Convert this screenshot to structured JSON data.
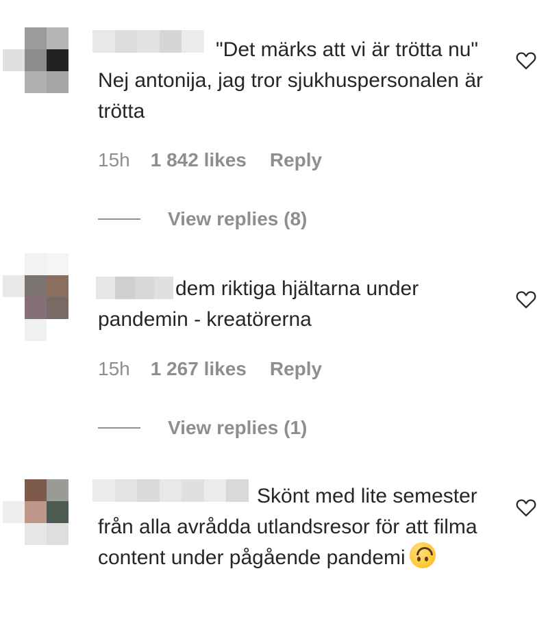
{
  "comments": [
    {
      "text": "\"Det märks att vi är trötta nu\" Nej antonija, jag tror sjukhuspersonalen är trötta",
      "time": "15h",
      "likes": "1 842 likes",
      "reply": "Reply",
      "view_replies": "View replies (8)",
      "avatar_colors": [
        "#ffffff",
        "#9b9b9b",
        "#b5b5b5",
        "#e0e0e0",
        "#8c8c8c",
        "#222222",
        "#ffffff",
        "#b0b0b0",
        "#a5a5a5"
      ],
      "redaction_colors": [
        "#e8e8e8",
        "#dcdcdc",
        "#e2e2e2",
        "#d6d6d6",
        "#ececec"
      ]
    },
    {
      "text": "dem riktiga hjältarna under pandemin - kreatörerna",
      "time": "15h",
      "likes": "1 267 likes",
      "reply": "Reply",
      "view_replies": "View replies (1)",
      "avatar_colors": [
        "#ffffff",
        "#f2f2f2",
        "#f5f5f5",
        "#e8e8e8",
        "#7b7472",
        "#8a6e5e",
        "#ffffff",
        "#857078",
        "#7a6a66",
        "#ffffff",
        "#f0f0f0",
        "#ffffff"
      ],
      "redaction_colors": [
        "#e6e6e6",
        "#cfcfcf",
        "#d8d8d8",
        "#e0e0e0"
      ]
    },
    {
      "text": "Skönt med lite semester från alla avrådda utlandsresor för att filma content under pågående pandemi",
      "emoji": "upside-down-face",
      "avatar_colors": [
        "#ffffff",
        "#7e5a4a",
        "#9a9a97",
        "#eeeeee",
        "#c0968a",
        "#4c5a52",
        "#ffffff",
        "#e6e6e6",
        "#dedede"
      ],
      "redaction_colors": [
        "#ececec",
        "#e4e4e4",
        "#dadada",
        "#e8e8e8",
        "#e0e0e0",
        "#ebebeb",
        "#d9d9d9"
      ]
    }
  ],
  "icons": {
    "like": "heart-outline-icon",
    "emoji": "upside-down-face-emoji"
  }
}
